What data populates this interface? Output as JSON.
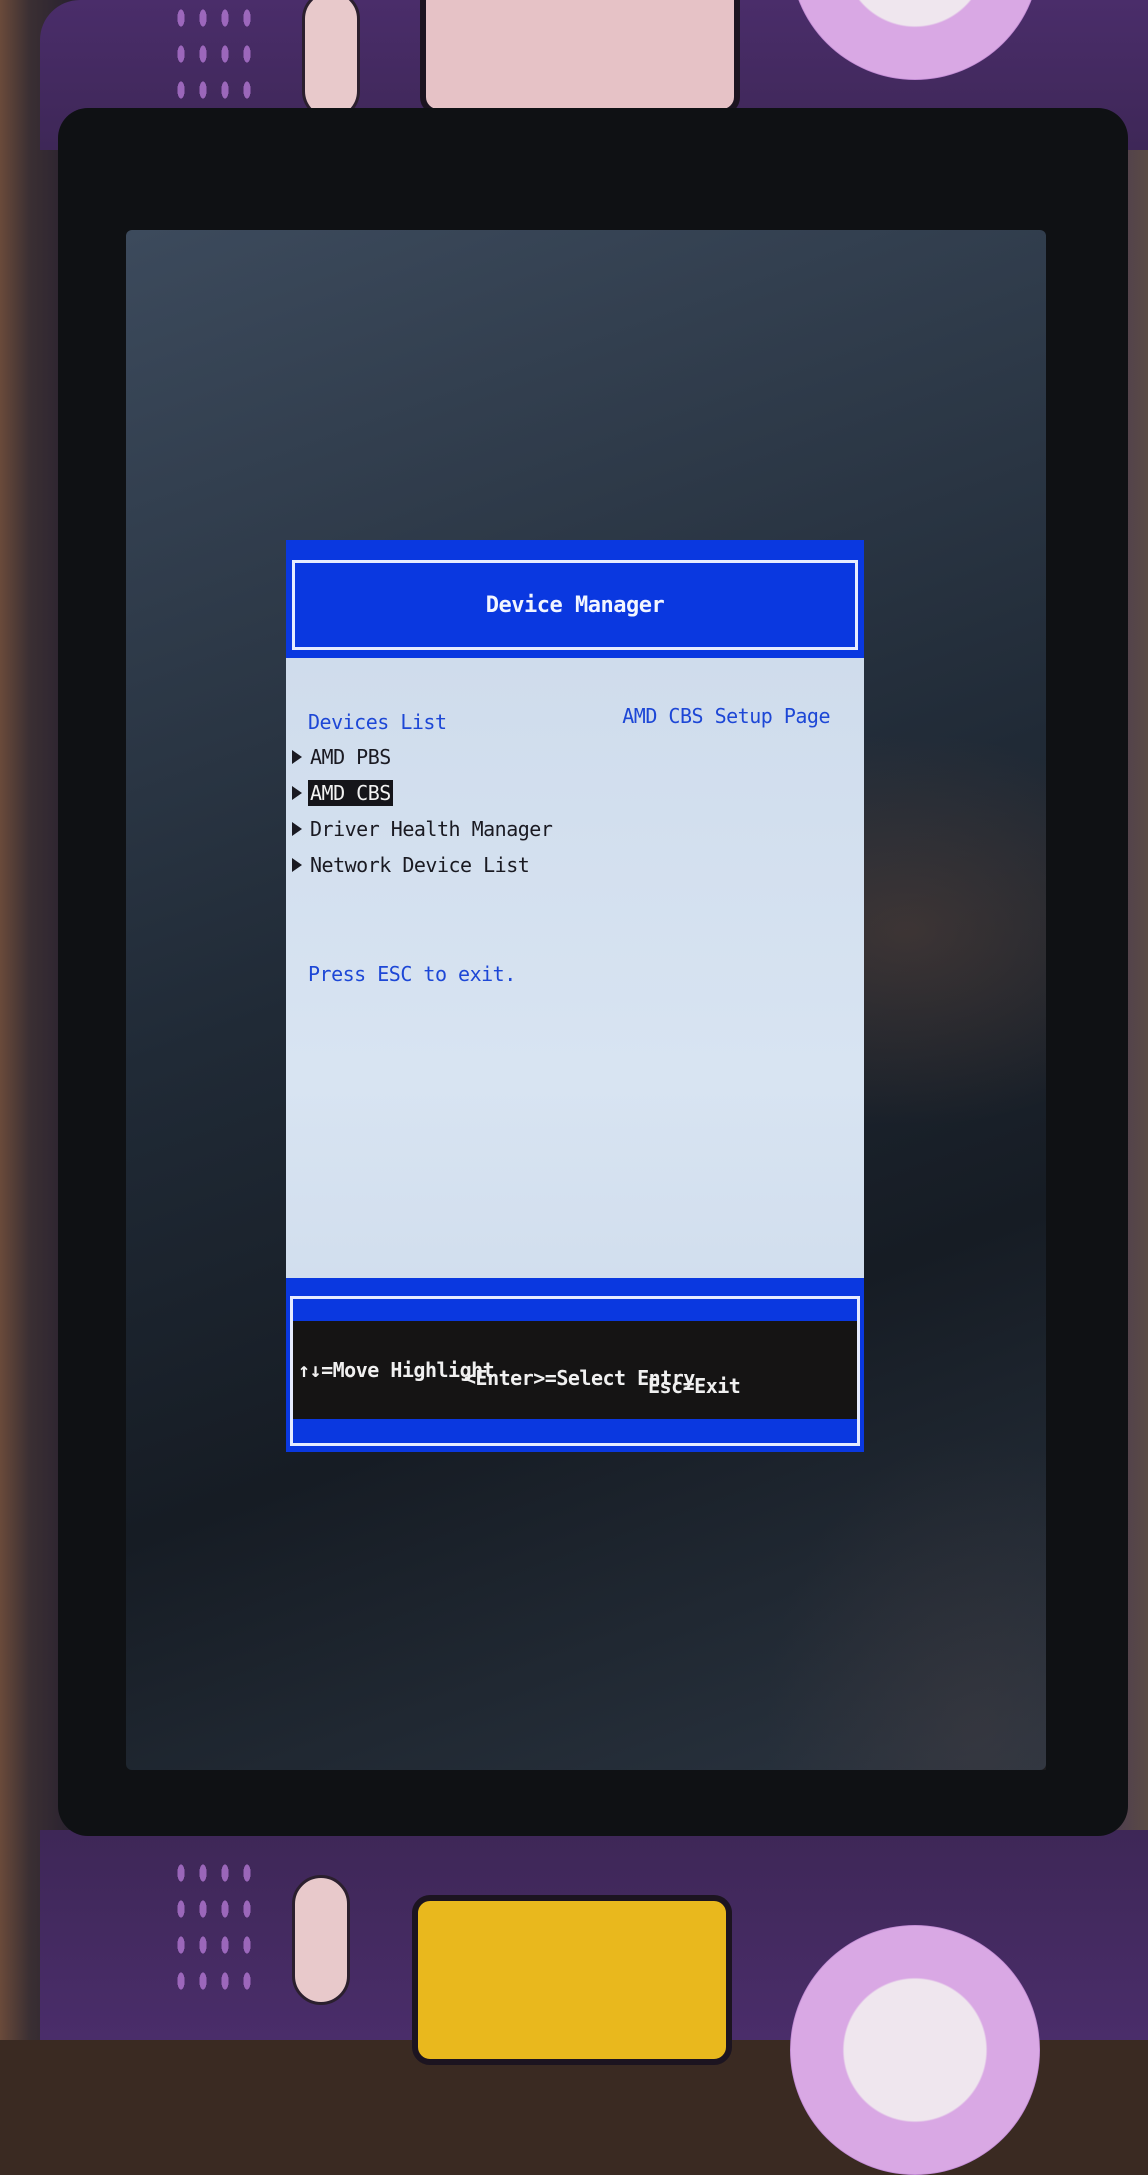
{
  "header": {
    "title": "Device Manager"
  },
  "section": {
    "title": "Devices List"
  },
  "help": {
    "title": "AMD CBS Setup Page"
  },
  "menu": {
    "items": [
      {
        "label": "AMD PBS",
        "selected": false
      },
      {
        "label": "AMD CBS",
        "selected": true
      },
      {
        "label": "Driver Health Manager",
        "selected": false
      },
      {
        "label": "Network Device List",
        "selected": false
      }
    ]
  },
  "note": {
    "text": "Press ESC to exit."
  },
  "footer": {
    "hints": [
      {
        "text": "↑↓=Move Highlight"
      },
      {
        "text": "<Enter>=Select Entry"
      },
      {
        "text": "Esc=Exit"
      }
    ]
  },
  "colors": {
    "bios_blue": "#0a38e0",
    "body_bg": "#d8e4f2",
    "accent_text": "#1d47d6",
    "selected_bg": "#15151a"
  },
  "icons": {
    "item_arrow": "triangle-right-icon"
  }
}
